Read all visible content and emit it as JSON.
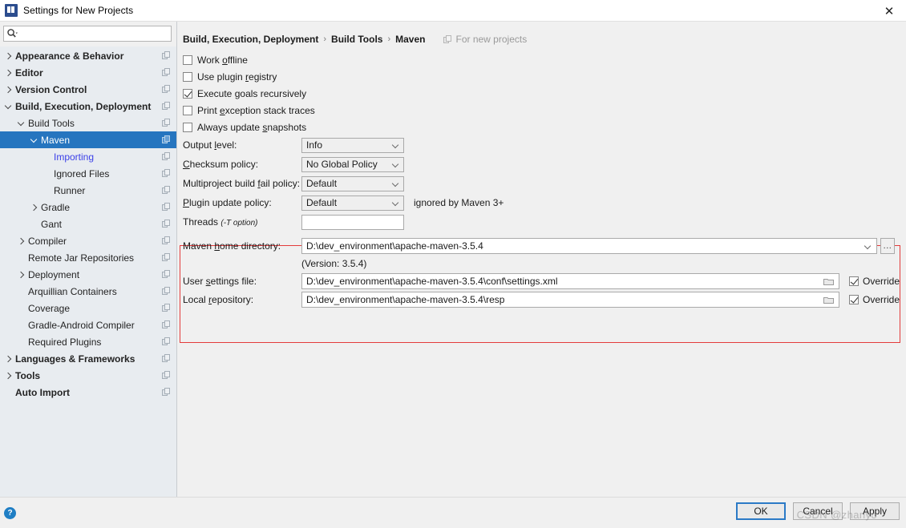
{
  "window": {
    "title": "Settings for New Projects",
    "app_icon": "intellij-idea-icon",
    "close_label": "✕"
  },
  "search": {
    "value": "",
    "placeholder": "",
    "icon": "search-icon"
  },
  "sidebar": {
    "items": [
      {
        "label": "Appearance & Behavior",
        "indent": 0,
        "arrow": "collapsed",
        "bold": true,
        "selected": false,
        "modified": false
      },
      {
        "label": "Editor",
        "indent": 0,
        "arrow": "collapsed",
        "bold": true,
        "selected": false,
        "modified": false
      },
      {
        "label": "Version Control",
        "indent": 0,
        "arrow": "collapsed",
        "bold": true,
        "selected": false,
        "modified": false
      },
      {
        "label": "Build, Execution, Deployment",
        "indent": 0,
        "arrow": "expanded",
        "bold": true,
        "selected": false,
        "modified": false
      },
      {
        "label": "Build Tools",
        "indent": 1,
        "arrow": "expanded",
        "bold": false,
        "selected": false,
        "modified": false
      },
      {
        "label": "Maven",
        "indent": 2,
        "arrow": "expanded",
        "bold": false,
        "selected": true,
        "modified": false
      },
      {
        "label": "Importing",
        "indent": 3,
        "arrow": "none",
        "bold": false,
        "selected": false,
        "modified": true
      },
      {
        "label": "Ignored Files",
        "indent": 3,
        "arrow": "none",
        "bold": false,
        "selected": false,
        "modified": false
      },
      {
        "label": "Runner",
        "indent": 3,
        "arrow": "none",
        "bold": false,
        "selected": false,
        "modified": false
      },
      {
        "label": "Gradle",
        "indent": 2,
        "arrow": "collapsed",
        "bold": false,
        "selected": false,
        "modified": false
      },
      {
        "label": "Gant",
        "indent": 2,
        "arrow": "none",
        "bold": false,
        "selected": false,
        "modified": false
      },
      {
        "label": "Compiler",
        "indent": 1,
        "arrow": "collapsed",
        "bold": false,
        "selected": false,
        "modified": false
      },
      {
        "label": "Remote Jar Repositories",
        "indent": 1,
        "arrow": "none",
        "bold": false,
        "selected": false,
        "modified": false
      },
      {
        "label": "Deployment",
        "indent": 1,
        "arrow": "collapsed",
        "bold": false,
        "selected": false,
        "modified": false
      },
      {
        "label": "Arquillian Containers",
        "indent": 1,
        "arrow": "none",
        "bold": false,
        "selected": false,
        "modified": false
      },
      {
        "label": "Coverage",
        "indent": 1,
        "arrow": "none",
        "bold": false,
        "selected": false,
        "modified": false
      },
      {
        "label": "Gradle-Android Compiler",
        "indent": 1,
        "arrow": "none",
        "bold": false,
        "selected": false,
        "modified": false
      },
      {
        "label": "Required Plugins",
        "indent": 1,
        "arrow": "none",
        "bold": false,
        "selected": false,
        "modified": false
      },
      {
        "label": "Languages & Frameworks",
        "indent": 0,
        "arrow": "collapsed",
        "bold": true,
        "selected": false,
        "modified": false
      },
      {
        "label": "Tools",
        "indent": 0,
        "arrow": "collapsed",
        "bold": true,
        "selected": false,
        "modified": false
      },
      {
        "label": "Auto Import",
        "indent": 0,
        "arrow": "none",
        "bold": true,
        "selected": false,
        "modified": false
      }
    ]
  },
  "content": {
    "breadcrumb": [
      "Build, Execution, Deployment",
      "Build Tools",
      "Maven"
    ],
    "breadcrumb_separator": "›",
    "for_new_projects": "For new projects",
    "checkboxes": [
      {
        "label_pre": "Work ",
        "mnemonic": "o",
        "label_post": "ffline",
        "checked": false
      },
      {
        "label_pre": "Use plugin ",
        "mnemonic": "r",
        "label_post": "egistry",
        "checked": false
      },
      {
        "label_pre": "Execute ",
        "mnemonic": "g",
        "label_post": "oals recursively",
        "checked": true
      },
      {
        "label_pre": "Print ",
        "mnemonic": "e",
        "label_post": "xception stack traces",
        "checked": false
      },
      {
        "label_pre": "Always update ",
        "mnemonic": "s",
        "label_post": "napshots",
        "checked": false
      }
    ],
    "combos": [
      {
        "label_pre": "Output ",
        "mnemonic": "l",
        "label_post": "evel:",
        "value": "Info",
        "hint": ""
      },
      {
        "label_pre": "",
        "mnemonic": "C",
        "label_post": "hecksum policy:",
        "value": "No Global Policy",
        "hint": ""
      },
      {
        "label_pre": "Multiproject build ",
        "mnemonic": "f",
        "label_post": "ail policy:",
        "value": "Default",
        "hint": ""
      },
      {
        "label_pre": "",
        "mnemonic": "P",
        "label_post": "lugin update policy:",
        "value": "Default",
        "hint": "ignored by Maven 3+"
      }
    ],
    "threads": {
      "label": "Threads",
      "label_note": "(-T option)",
      "value": "",
      "placeholder": ""
    },
    "maven_home": {
      "label_pre": "Maven ",
      "mnemonic": "h",
      "label_post": "ome directory:",
      "value": "D:\\dev_environment\\apache-maven-3.5.4",
      "browse_label": "...",
      "version_note": "(Version: 3.5.4)"
    },
    "user_settings": {
      "label_pre": "User ",
      "mnemonic": "s",
      "label_post": "ettings file:",
      "value": "D:\\dev_environment\\apache-maven-3.5.4\\conf\\settings.xml",
      "override_label": "Override",
      "override_checked": true
    },
    "local_repository": {
      "label_pre": "Local ",
      "mnemonic": "r",
      "label_post": "epository:",
      "value": "D:\\dev_environment\\apache-maven-3.5.4\\resp",
      "override_label": "Override",
      "override_checked": true
    },
    "highlight_color": "#e33b3b"
  },
  "footer": {
    "help_label": "?",
    "ok_label": "OK",
    "cancel_label": "Cancel",
    "apply_label": "Apply",
    "watermark": "CSDN @zhanyo"
  }
}
